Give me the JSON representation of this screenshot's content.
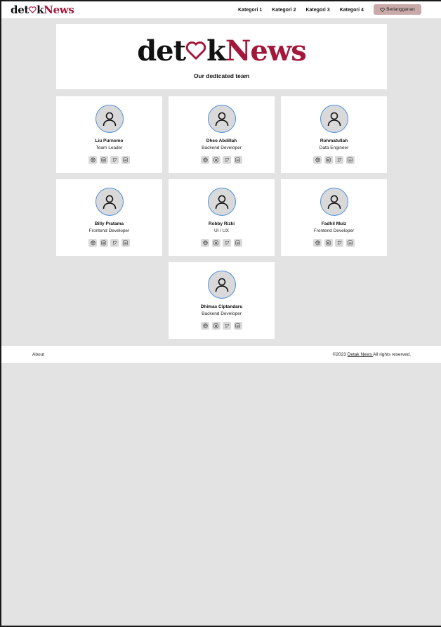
{
  "nav": {
    "logo": {
      "part1": "det",
      "part2": "k",
      "part3": "News"
    },
    "links": [
      "Kategori 1",
      "Kategori 2",
      "Kategori 3",
      "Kategori 4"
    ],
    "subscribe_label": "Berlangganan"
  },
  "hero": {
    "logo": {
      "part1": "det",
      "part2": "k",
      "part3": "News"
    },
    "subtitle": "Our dedicated team"
  },
  "team": [
    {
      "name": "Liu Purnomo",
      "role": "Team Leader"
    },
    {
      "name": "Dheo Abdillah",
      "role": "Backend Developer"
    },
    {
      "name": "Rohmatullah",
      "role": "Data Engineer"
    },
    {
      "name": "Billy Pratama",
      "role": "Frontend Developer"
    },
    {
      "name": "Robby Rizki",
      "role": "UI / UX"
    },
    {
      "name": "Fadhil Muiz",
      "role": "Frontend Developer"
    },
    {
      "name": "Dhimas Ciptandaru",
      "role": "Backend Developer"
    }
  ],
  "socials": [
    "globe-icon",
    "instagram-icon",
    "twitter-icon",
    "linkedin-icon"
  ],
  "footer": {
    "about": "About",
    "copy_prefix": "©2023 ",
    "copy_link": "Detak News ",
    "copy_suffix": "All rights reserved."
  },
  "colors": {
    "brand_red": "#a3173a",
    "subscribe_bg": "#c9aaa9",
    "avatar_border": "#4d8fe3",
    "page_bg": "#e3e3e3"
  }
}
